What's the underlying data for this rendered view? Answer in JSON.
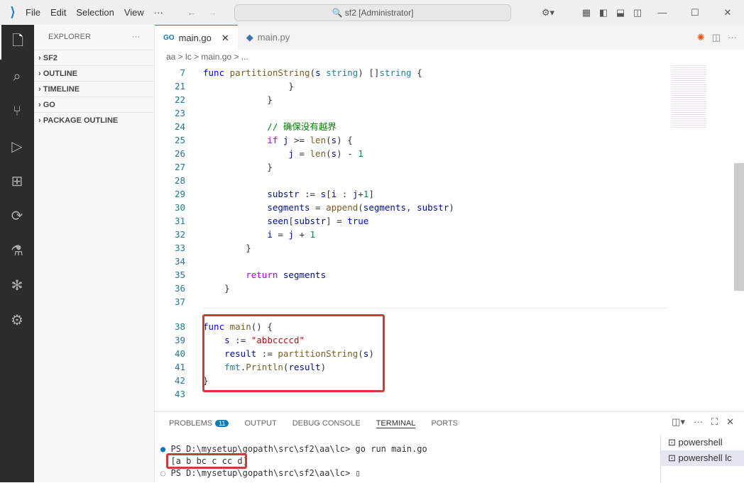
{
  "titlebar": {
    "menu": [
      "File",
      "Edit",
      "Selection",
      "View",
      "···"
    ],
    "search": "sf2 [Administrator]"
  },
  "sidebar": {
    "title": "EXPLORER",
    "sections": [
      "SF2",
      "OUTLINE",
      "TIMELINE",
      "GO",
      "PACKAGE OUTLINE"
    ]
  },
  "tabs": [
    {
      "label": "main.go",
      "icon": "GO"
    },
    {
      "label": "main.py"
    }
  ],
  "breadcrumb": "aa > lc > main.go > ...",
  "code": [
    {
      "n": "7",
      "t": [
        [
          "func ",
          "k"
        ],
        [
          "partitionString",
          "f"
        ],
        [
          "(",
          "p"
        ],
        [
          "s ",
          "v"
        ],
        [
          "string",
          "t"
        ],
        [
          ") []",
          "p"
        ],
        [
          "string",
          "t"
        ],
        [
          " {",
          "p"
        ]
      ]
    },
    {
      "n": "21",
      "t": [
        [
          "                }",
          "p"
        ]
      ]
    },
    {
      "n": "22",
      "t": [
        [
          "            }",
          "p"
        ]
      ]
    },
    {
      "n": "23",
      "t": []
    },
    {
      "n": "24",
      "t": [
        [
          "            // 确保没有越界",
          "c"
        ]
      ]
    },
    {
      "n": "25",
      "t": [
        [
          "            ",
          "p"
        ],
        [
          "if ",
          "kc"
        ],
        [
          "j",
          "v"
        ],
        [
          " >= ",
          "p"
        ],
        [
          "len",
          "f"
        ],
        [
          "(",
          "p"
        ],
        [
          "s",
          "v"
        ],
        [
          ") {",
          "p"
        ]
      ]
    },
    {
      "n": "26",
      "t": [
        [
          "                ",
          "p"
        ],
        [
          "j",
          "v"
        ],
        [
          " = ",
          "p"
        ],
        [
          "len",
          "f"
        ],
        [
          "(",
          "p"
        ],
        [
          "s",
          "v"
        ],
        [
          ") - ",
          "p"
        ],
        [
          "1",
          "n"
        ]
      ]
    },
    {
      "n": "27",
      "t": [
        [
          "            }",
          "p"
        ]
      ]
    },
    {
      "n": "28",
      "t": []
    },
    {
      "n": "29",
      "t": [
        [
          "            ",
          "p"
        ],
        [
          "substr",
          "v"
        ],
        [
          " := ",
          "p"
        ],
        [
          "s",
          "v"
        ],
        [
          "[",
          "p"
        ],
        [
          "i",
          "v"
        ],
        [
          " : ",
          "p"
        ],
        [
          "j",
          "v"
        ],
        [
          "+",
          "p"
        ],
        [
          "1",
          "n"
        ],
        [
          "]",
          "p"
        ]
      ]
    },
    {
      "n": "30",
      "t": [
        [
          "            ",
          "p"
        ],
        [
          "segments",
          "v"
        ],
        [
          " = ",
          "p"
        ],
        [
          "append",
          "f"
        ],
        [
          "(",
          "p"
        ],
        [
          "segments",
          "v"
        ],
        [
          ", ",
          "p"
        ],
        [
          "substr",
          "v"
        ],
        [
          ")",
          "p"
        ]
      ]
    },
    {
      "n": "31",
      "t": [
        [
          "            ",
          "p"
        ],
        [
          "seen",
          "v"
        ],
        [
          "[",
          "p"
        ],
        [
          "substr",
          "v"
        ],
        [
          "] = ",
          "p"
        ],
        [
          "true",
          "k"
        ]
      ]
    },
    {
      "n": "32",
      "t": [
        [
          "            ",
          "p"
        ],
        [
          "i",
          "v"
        ],
        [
          " = ",
          "p"
        ],
        [
          "j",
          "v"
        ],
        [
          " + ",
          "p"
        ],
        [
          "1",
          "n"
        ]
      ]
    },
    {
      "n": "33",
      "t": [
        [
          "        }",
          "p"
        ]
      ]
    },
    {
      "n": "34",
      "t": []
    },
    {
      "n": "35",
      "t": [
        [
          "        ",
          "p"
        ],
        [
          "return ",
          "kc"
        ],
        [
          "segments",
          "v"
        ]
      ]
    },
    {
      "n": "36",
      "t": [
        [
          "    }",
          "p"
        ]
      ]
    },
    {
      "n": "37",
      "t": []
    },
    {
      "n": "38",
      "t": [
        [
          "func ",
          "k"
        ],
        [
          "main",
          "f"
        ],
        [
          "() {",
          "p"
        ]
      ]
    },
    {
      "n": "39",
      "t": [
        [
          "    ",
          "p"
        ],
        [
          "s",
          "v"
        ],
        [
          " := ",
          "p"
        ],
        [
          "\"abbccccd\"",
          "s"
        ]
      ]
    },
    {
      "n": "40",
      "t": [
        [
          "    ",
          "p"
        ],
        [
          "result",
          "v"
        ],
        [
          " := ",
          "p"
        ],
        [
          "partitionString",
          "f"
        ],
        [
          "(",
          "p"
        ],
        [
          "s",
          "v"
        ],
        [
          ")",
          "p"
        ]
      ]
    },
    {
      "n": "41",
      "t": [
        [
          "    ",
          "p"
        ],
        [
          "fmt",
          "t"
        ],
        [
          ".",
          "p"
        ],
        [
          "Println",
          "f"
        ],
        [
          "(",
          "p"
        ],
        [
          "result",
          "v"
        ],
        [
          ")",
          "p"
        ]
      ]
    },
    {
      "n": "42",
      "t": [
        [
          "}",
          "p"
        ]
      ]
    },
    {
      "n": "43",
      "t": []
    }
  ],
  "panel": {
    "tabs": [
      "PROBLEMS",
      "OUTPUT",
      "DEBUG CONSOLE",
      "TERMINAL",
      "PORTS"
    ],
    "problems_count": "11",
    "terminal": [
      "PS D:\\mysetup\\gopath\\src\\sf2\\aa\\lc> go run main.go",
      "[a b bc c cc d]",
      "PS D:\\mysetup\\gopath\\src\\sf2\\aa\\lc> ▯"
    ],
    "terminals": [
      "powershell",
      "powershell lc"
    ]
  }
}
